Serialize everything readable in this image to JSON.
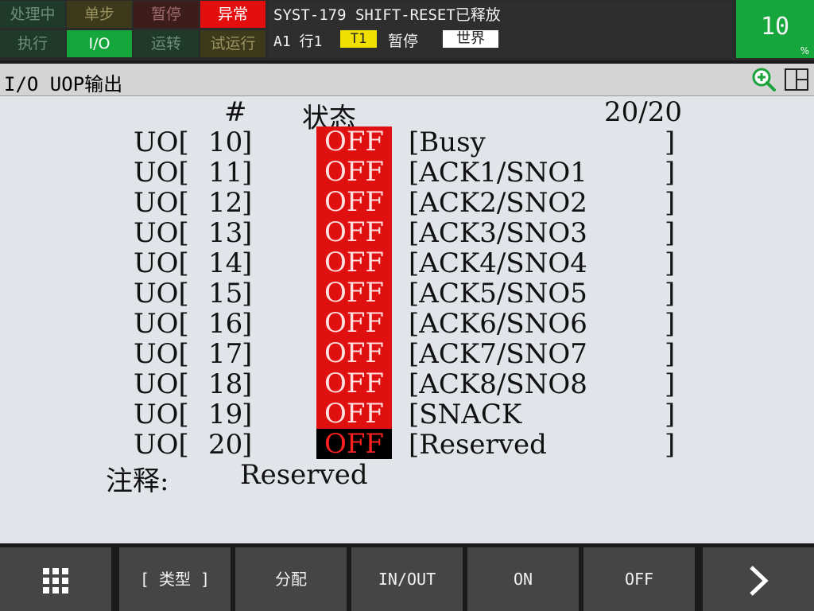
{
  "status_buttons": [
    {
      "label": "处理中",
      "bg": "#1f3a2a",
      "fg": "#6b8f77"
    },
    {
      "label": "单步",
      "bg": "#3d3a1c",
      "fg": "#9a9460"
    },
    {
      "label": "暂停",
      "bg": "#3d1c1c",
      "fg": "#a06b6b"
    },
    {
      "label": "异常",
      "bg": "#e30f0f",
      "fg": "#ffffff"
    },
    {
      "label": "执行",
      "bg": "#1f3a2a",
      "fg": "#6b8f77"
    },
    {
      "label": "I/O",
      "bg": "#15a63c",
      "fg": "#ffffff"
    },
    {
      "label": "运转",
      "bg": "#1f3a2a",
      "fg": "#6b8f77"
    },
    {
      "label": "试运行",
      "bg": "#3d3a1c",
      "fg": "#9a9460"
    }
  ],
  "message": {
    "line1": "SYST-179 SHIFT-RESET已释放",
    "line2": "A1 行1",
    "mode": "T1",
    "state": "暂停",
    "frame": "世界"
  },
  "override": {
    "value": "10",
    "unit": "%"
  },
  "title": "I/O UOP输出",
  "icons": {
    "zoom": "zoom-in-icon",
    "layout": "split-view-icon"
  },
  "table": {
    "col_num": "#",
    "col_state": "状态",
    "page": "20/20",
    "rows": [
      {
        "prefix": "UO[",
        "index": "10",
        "state": "OFF",
        "comment": "[Busy"
      },
      {
        "prefix": "UO[",
        "index": "11",
        "state": "OFF",
        "comment": "[ACK1/SNO1"
      },
      {
        "prefix": "UO[",
        "index": "12",
        "state": "OFF",
        "comment": "[ACK2/SNO2"
      },
      {
        "prefix": "UO[",
        "index": "13",
        "state": "OFF",
        "comment": "[ACK3/SNO3"
      },
      {
        "prefix": "UO[",
        "index": "14",
        "state": "OFF",
        "comment": "[ACK4/SNO4"
      },
      {
        "prefix": "UO[",
        "index": "15",
        "state": "OFF",
        "comment": "[ACK5/SNO5"
      },
      {
        "prefix": "UO[",
        "index": "16",
        "state": "OFF",
        "comment": "[ACK6/SNO6"
      },
      {
        "prefix": "UO[",
        "index": "17",
        "state": "OFF",
        "comment": "[ACK7/SNO7"
      },
      {
        "prefix": "UO[",
        "index": "18",
        "state": "OFF",
        "comment": "[ACK8/SNO8"
      },
      {
        "prefix": "UO[",
        "index": "19",
        "state": "OFF",
        "comment": "[SNACK"
      },
      {
        "prefix": "UO[",
        "index": "20",
        "state": "OFF",
        "comment": "[Reserved",
        "selected": true
      }
    ]
  },
  "remark": {
    "label": "注释:",
    "value": "Reserved"
  },
  "function_keys": [
    {
      "label": "",
      "icon": "menu-grid-icon"
    },
    {
      "label": "[ 类型 ]"
    },
    {
      "label": "分配"
    },
    {
      "label": "IN/OUT"
    },
    {
      "label": "ON"
    },
    {
      "label": "OFF"
    },
    {
      "label": "",
      "icon": "next-page-icon"
    }
  ],
  "colors": {
    "state_off": "#e01010",
    "state_selected": "#000000",
    "override_bg": "#15a63c",
    "content_bg": "#e1e4e8"
  }
}
